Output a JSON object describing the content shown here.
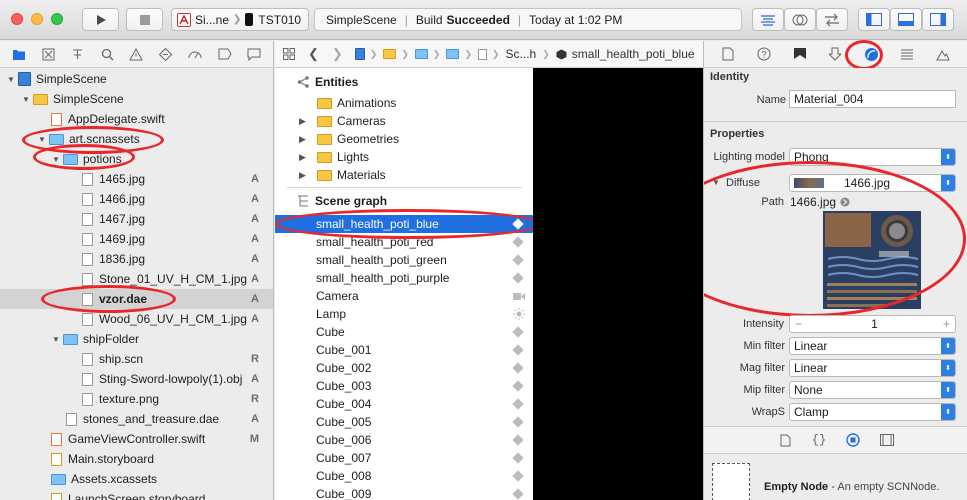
{
  "toolbar": {
    "scheme_target": "Si...ne",
    "scheme_device": "TST010",
    "activity_project": "SimpleScene",
    "activity_status_prefix": "Build",
    "activity_status": "Succeeded",
    "activity_time": "Today at 1:02 PM"
  },
  "navigator": {
    "items": [
      {
        "label": "SimpleScene",
        "badge": ""
      },
      {
        "label": "SimpleScene",
        "badge": ""
      },
      {
        "label": "AppDelegate.swift",
        "badge": ""
      },
      {
        "label": "art.scnassets",
        "badge": ""
      },
      {
        "label": "potions",
        "badge": ""
      },
      {
        "label": "1465.jpg",
        "badge": "A"
      },
      {
        "label": "1466.jpg",
        "badge": "A"
      },
      {
        "label": "1467.jpg",
        "badge": "A"
      },
      {
        "label": "1469.jpg",
        "badge": "A"
      },
      {
        "label": "1836.jpg",
        "badge": "A"
      },
      {
        "label": "Stone_01_UV_H_CM_1.jpg",
        "badge": "A"
      },
      {
        "label": "vzor.dae",
        "badge": "A"
      },
      {
        "label": "Wood_06_UV_H_CM_1.jpg",
        "badge": "A"
      },
      {
        "label": "shipFolder",
        "badge": ""
      },
      {
        "label": "ship.scn",
        "badge": "R"
      },
      {
        "label": "Sting-Sword-lowpoly(1).obj",
        "badge": "A"
      },
      {
        "label": "texture.png",
        "badge": "R"
      },
      {
        "label": "stones_and_treasure.dae",
        "badge": "A"
      },
      {
        "label": "GameViewController.swift",
        "badge": "M"
      },
      {
        "label": "Main.storyboard",
        "badge": ""
      },
      {
        "label": "Assets.xcassets",
        "badge": ""
      },
      {
        "label": "LaunchScreen.storyboard",
        "badge": ""
      }
    ]
  },
  "jumpbar": {
    "file_short": "Sc...h",
    "node": "small_health_poti_blue"
  },
  "scene": {
    "entities_header": "Entities",
    "entities": [
      "Animations",
      "Cameras",
      "Geometries",
      "Lights",
      "Materials"
    ],
    "graph_header": "Scene graph",
    "nodes": [
      "small_health_poti_blue",
      "small_health_poti_red",
      "small_health_poti_green",
      "small_health_poti_purple",
      "Camera",
      "Lamp",
      "Cube",
      "Cube_001",
      "Cube_002",
      "Cube_003",
      "Cube_004",
      "Cube_005",
      "Cube_006",
      "Cube_007",
      "Cube_008",
      "Cube_009"
    ]
  },
  "inspector": {
    "identity_header": "Identity",
    "name_label": "Name",
    "name_value": "Material_004",
    "properties_header": "Properties",
    "lighting_label": "Lighting model",
    "lighting_value": "Phong",
    "diffuse_label": "Diffuse",
    "diffuse_value": "1466.jpg",
    "path_label": "Path",
    "path_value": "1466.jpg",
    "intensity_label": "Intensity",
    "intensity_value": "1",
    "intensity_minus": "−",
    "intensity_plus": "+",
    "min_filter_label": "Min filter",
    "min_filter_value": "Linear",
    "mag_filter_label": "Mag filter",
    "mag_filter_value": "Linear",
    "mip_filter_label": "Mip filter",
    "mip_filter_value": "None",
    "wraps_label": "WrapS",
    "wraps_value": "Clamp",
    "library_title": "Empty Node",
    "library_desc": "- An empty SCNNode."
  },
  "colors": {
    "accent": "#1f6fe0",
    "annotation": "#e9262a",
    "selection": "#1f6fe0"
  }
}
